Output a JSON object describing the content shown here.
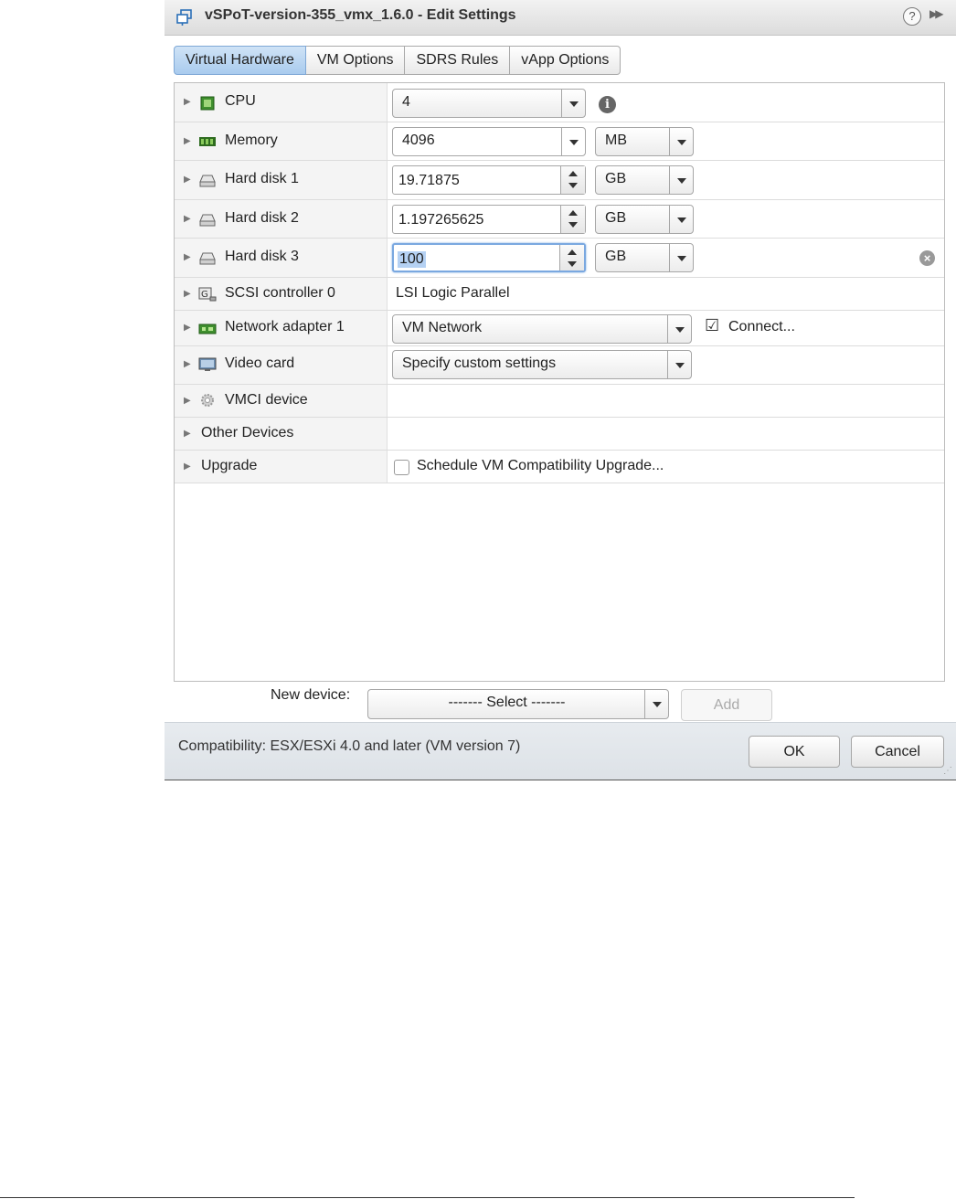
{
  "window": {
    "title": "vSPoT-version-355_vmx_1.6.0 - Edit Settings",
    "help_glyph": "?",
    "expand_glyph": "▶▶"
  },
  "tabs": [
    {
      "label": "Virtual Hardware",
      "active": true
    },
    {
      "label": "VM Options",
      "active": false
    },
    {
      "label": "SDRS Rules",
      "active": false
    },
    {
      "label": "vApp Options",
      "active": false
    }
  ],
  "hardware": {
    "cpu": {
      "label": "CPU",
      "value": "4",
      "icon": "cpu-icon"
    },
    "memory": {
      "label": "Memory",
      "value": "4096",
      "unit": "MB",
      "icon": "memory-icon"
    },
    "disk1": {
      "label": "Hard disk 1",
      "value": "19.71875",
      "unit": "GB",
      "icon": "hard-disk-icon"
    },
    "disk2": {
      "label": "Hard disk 2",
      "value": "1.197265625",
      "unit": "GB",
      "icon": "hard-disk-icon"
    },
    "disk3": {
      "label": "Hard disk 3",
      "value": "100",
      "unit": "GB",
      "icon": "hard-disk-icon"
    },
    "scsi": {
      "label": "SCSI controller 0",
      "value": "LSI Logic Parallel",
      "icon": "scsi-controller-icon"
    },
    "network": {
      "label": "Network adapter 1",
      "value": "VM Network",
      "connect_label": "Connect...",
      "connected": true,
      "icon": "network-adapter-icon"
    },
    "video": {
      "label": "Video card",
      "value": "Specify custom settings",
      "icon": "video-card-icon"
    },
    "vmci": {
      "label": "VMCI device",
      "icon": "gear-icon"
    },
    "other": {
      "label": "Other Devices"
    },
    "upgrade": {
      "label": "Upgrade",
      "checkbox_label": "Schedule VM Compatibility Upgrade...",
      "checked": false
    }
  },
  "new_device": {
    "label": "New device:",
    "select_value": "------- Select -------",
    "add_label": "Add"
  },
  "footer": {
    "compatibility": "Compatibility: ESX/ESXi 4.0 and later (VM version 7)",
    "ok_label": "OK",
    "cancel_label": "Cancel"
  },
  "colors": {
    "active_tab": "#a9cbee",
    "focus_ring": "#7aa8e0",
    "footer_bg": "#e1e5ea"
  }
}
